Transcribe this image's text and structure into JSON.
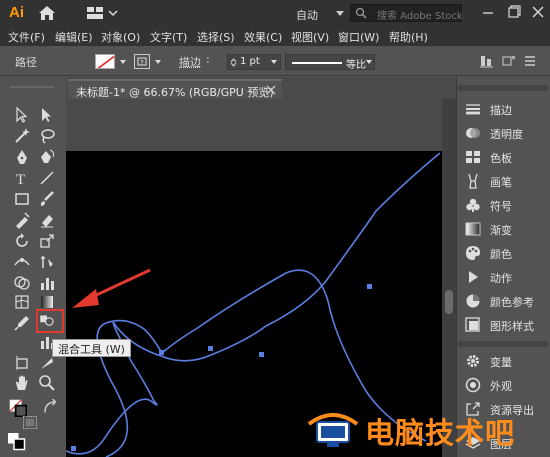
{
  "app": {
    "logo": "Ai",
    "workspace": "自动",
    "search_placeholder": "搜索 Adobe Stock"
  },
  "menu": [
    "文件(F)",
    "编辑(E)",
    "对象(O)",
    "文字(T)",
    "选择(S)",
    "效果(C)",
    "视图(V)",
    "窗口(W)",
    "帮助(H)"
  ],
  "control": {
    "selection_label": "路径",
    "stroke_label": "描边",
    "stroke_value": "1 pt",
    "profile_label": "等比"
  },
  "document": {
    "tab_title": "未标题-1* @ 66.67% (RGB/GPU 预览)"
  },
  "tooltip": {
    "text": "混合工具 (W)"
  },
  "panels": {
    "group1": [
      {
        "label": "描边",
        "icon": "stroke-lines-icon"
      },
      {
        "label": "透明度",
        "icon": "transparency-circle-icon"
      },
      {
        "label": "色板",
        "icon": "swatches-grid-icon"
      },
      {
        "label": "画笔",
        "icon": "brush-icon"
      },
      {
        "label": "符号",
        "icon": "club-icon"
      },
      {
        "label": "渐变",
        "icon": "gradient-square-icon"
      },
      {
        "label": "颜色",
        "icon": "palette-icon"
      },
      {
        "label": "动作",
        "icon": "play-icon"
      },
      {
        "label": "颜色参考",
        "icon": "color-guide-icon"
      },
      {
        "label": "图形样式",
        "icon": "graphic-styles-icon"
      }
    ],
    "group2": [
      {
        "label": "变量",
        "icon": "gear-icon"
      },
      {
        "label": "外观",
        "icon": "appearance-circle-icon"
      },
      {
        "label": "资源导出",
        "icon": "export-icon"
      },
      {
        "label": "图层",
        "icon": "layers-icon"
      }
    ]
  },
  "watermark": {
    "text": "电脑技术吧"
  },
  "colors": {
    "accent": "#ff9a00",
    "path": "#5b7fe0",
    "arrow": "#e23a2e",
    "watermark": "#ff8c1a"
  }
}
